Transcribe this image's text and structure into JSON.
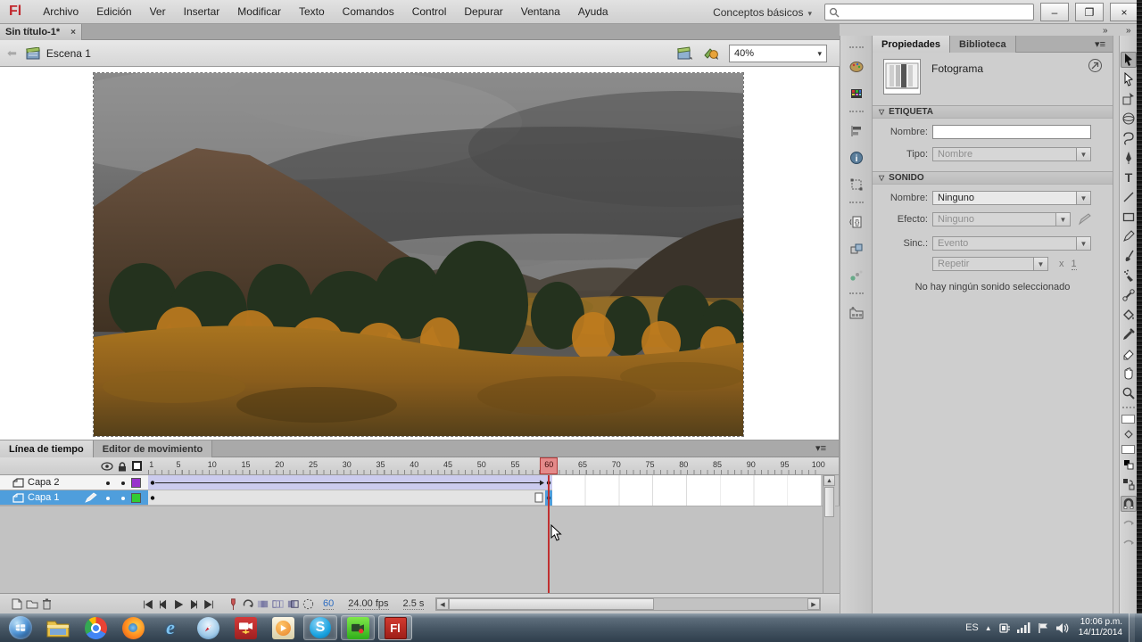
{
  "menubar": {
    "logo": "Fl",
    "items": [
      "Archivo",
      "Edición",
      "Ver",
      "Insertar",
      "Modificar",
      "Texto",
      "Comandos",
      "Control",
      "Depurar",
      "Ventana",
      "Ayuda"
    ],
    "workspace": "Conceptos básicos",
    "workspace_caret": "▾",
    "window_buttons": {
      "minimize": "–",
      "restore": "❐",
      "close": "×"
    }
  },
  "document_tab": {
    "title": "Sin título-1*",
    "close": "×"
  },
  "edit_bar": {
    "back_arrow": "⬅",
    "scene_name": "Escena 1",
    "zoom_value": "40%",
    "zoom_caret": "▾"
  },
  "properties_panel": {
    "tabs": [
      {
        "label": "Propiedades",
        "active": true
      },
      {
        "label": "Biblioteca",
        "active": false
      }
    ],
    "panel_menu_icon": "▾≡",
    "frame_type": "Fotograma",
    "etiqueta": {
      "title": "ETIQUETA",
      "collapse_tri": "▽",
      "nombre_label": "Nombre:",
      "nombre_value": "",
      "tipo_label": "Tipo:",
      "tipo_value": "Nombre"
    },
    "sonido": {
      "title": "SONIDO",
      "collapse_tri": "▽",
      "nombre_label": "Nombre:",
      "nombre_value": "Ninguno",
      "efecto_label": "Efecto:",
      "efecto_value": "Ninguno",
      "sinc_label": "Sinc.:",
      "sinc_value": "Evento",
      "repetir_value": "Repetir",
      "times_label": "x",
      "times_value": "1",
      "status_text": "No hay ningún sonido seleccionado"
    }
  },
  "dock_strip": {
    "groups": [
      [
        "color-panel-icon",
        "swatches-panel-icon"
      ],
      [
        "align-panel-icon",
        "info-panel-icon",
        "transform-panel-icon"
      ],
      [
        "code-snippets-panel-icon",
        "components-panel-icon",
        "motion-presets-panel-icon"
      ],
      [
        "project-panel-icon"
      ]
    ]
  },
  "tools_panel": {
    "tools": [
      "selection-tool",
      "subselection-tool",
      "free-transform-tool",
      "3d-rotation-tool",
      "lasso-tool",
      "pen-tool",
      "text-tool",
      "line-tool",
      "rectangle-tool",
      "pencil-tool",
      "brush-tool",
      "spray-brush-tool",
      "bone-tool",
      "paint-bucket-tool",
      "eyedropper-tool",
      "eraser-tool",
      "hand-tool",
      "zoom-tool"
    ],
    "active_tool": "selection-tool",
    "stroke_color": "#ffffff",
    "fill_color": "#ffffff",
    "snap_active": true
  },
  "timeline": {
    "tabs": [
      {
        "label": "Línea de tiempo",
        "active": true
      },
      {
        "label": "Editor de movimiento",
        "active": false
      }
    ],
    "panel_menu_icon": "▾≡",
    "ruler_numbers": [
      1,
      5,
      10,
      15,
      20,
      25,
      30,
      35,
      40,
      45,
      50,
      55,
      60,
      65,
      70,
      75,
      80,
      85,
      90,
      95,
      100
    ],
    "playhead_frame": 60,
    "layers": [
      {
        "name": "Capa 2",
        "color": "#9933cc",
        "selected": false,
        "pencil": false,
        "span": "tween"
      },
      {
        "name": "Capa 1",
        "color": "#33cc33",
        "selected": true,
        "pencil": true,
        "span": "static"
      }
    ],
    "status": {
      "current_frame": "60",
      "fps": "24.00 fps",
      "elapsed": "2.5 s"
    }
  },
  "taskbar": {
    "apps": [
      {
        "name": "start-button",
        "open": false,
        "front": false
      },
      {
        "name": "explorer-icon",
        "open": false,
        "front": false
      },
      {
        "name": "chrome-icon",
        "open": false,
        "front": false
      },
      {
        "name": "firefox-icon",
        "open": false,
        "front": false
      },
      {
        "name": "ie-icon",
        "open": false,
        "front": false
      },
      {
        "name": "safari-icon",
        "open": false,
        "front": false
      },
      {
        "name": "atube-icon",
        "open": false,
        "front": false
      },
      {
        "name": "mediaplayer-icon",
        "open": false,
        "front": false
      },
      {
        "name": "skype-icon",
        "open": true,
        "front": false
      },
      {
        "name": "recorder-icon",
        "open": true,
        "front": false
      },
      {
        "name": "flash-icon",
        "open": true,
        "front": true
      }
    ],
    "language": "ES",
    "time": "10:06 p.m.",
    "date": "14/11/2014"
  }
}
